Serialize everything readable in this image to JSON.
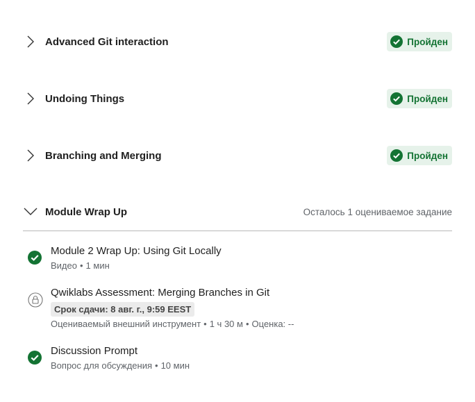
{
  "sections": [
    {
      "title": "Advanced Git interaction",
      "status": "Пройден"
    },
    {
      "title": "Undoing Things",
      "status": "Пройден"
    },
    {
      "title": "Branching and Merging",
      "status": "Пройден"
    }
  ],
  "module": {
    "title": "Module Wrap Up",
    "remaining": "Осталось 1 оцениваемое задание"
  },
  "items": [
    {
      "title": "Module 2 Wrap Up: Using Git Locally",
      "type": "Видео",
      "duration": "1 мин",
      "icon": "check-circle-icon"
    },
    {
      "title": "Qwiklabs Assessment: Merging Branches in Git",
      "due": "Срок сдачи: 8 авг. г., 9:59 EEST",
      "type": "Оцениваемый внешний инструмент",
      "duration": "1 ч 30 м",
      "grade": "Оценка: --",
      "icon": "lock-icon"
    },
    {
      "title": "Discussion Prompt",
      "type": "Вопрос для обсуждения",
      "duration": "10 мин",
      "icon": "check-circle-icon"
    }
  ],
  "colors": {
    "success": "#137333",
    "success_bg": "#e6f2ea",
    "text": "#1f1f1f",
    "muted": "#5f6368"
  }
}
